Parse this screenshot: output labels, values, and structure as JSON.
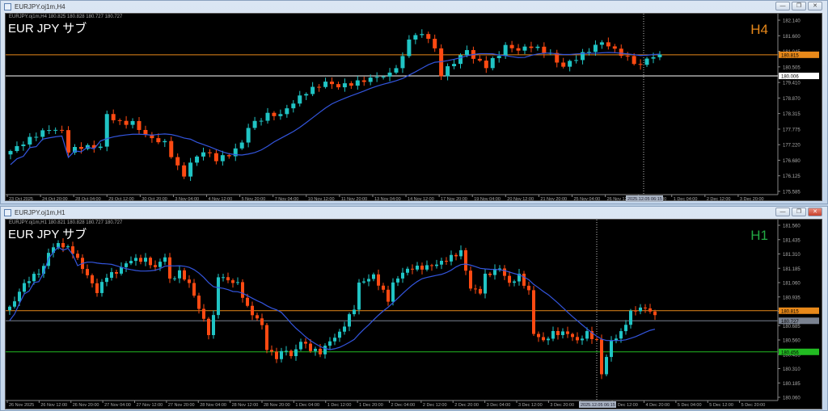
{
  "windows": [
    {
      "title": "EURJPY.oj1m,H4",
      "info": "EURJPY.oj1m,H4  180.825 180.828 180.727 180.727",
      "symbol_label": "EUR JPY  サブ",
      "timeframe": "H4",
      "timeframe_color": "#e8891a",
      "price_ticks": [
        "182.140",
        "181.600",
        "181.045",
        "180.505",
        "179.410",
        "178.870",
        "178.315",
        "177.775",
        "177.220",
        "176.680",
        "176.125",
        "175.585"
      ],
      "price_range": [
        175.585,
        182.14
      ],
      "level_lines": [
        {
          "price": 180.815,
          "label": "180.815",
          "color": "#e8891a"
        },
        {
          "price": 180.006,
          "label": "180.006",
          "color": "#ffffff"
        }
      ],
      "crosshair_time": "2025.12.05 06:15",
      "time_labels": [
        "23 Oct 2025",
        "24 Oct 20:00",
        "28 Oct 04:00",
        "29 Oct 12:00",
        "30 Oct 20:00",
        "3 Nov 04:00",
        "4 Nov 12:00",
        "5 Nov 20:00",
        "7 Nov 04:00",
        "10 Nov 12:00",
        "11 Nov 20:00",
        "13 Nov 04:00",
        "14 Nov 12:00",
        "17 Nov 20:00",
        "19 Nov 04:00",
        "20 Nov 12:00",
        "21 Nov 20:00",
        "25 Nov 04:00",
        "26 Nov 12:00",
        "27 Nov 20:00",
        "1 Dec 04:00",
        "2 Dec 12:00",
        "3 Dec 20:00"
      ],
      "candle_count": 102,
      "anchors": [
        [
          0,
          177.13
        ],
        [
          4,
          177.75
        ],
        [
          6,
          177.97
        ],
        [
          8,
          177.9
        ],
        [
          9,
          177.13
        ],
        [
          11,
          177.29
        ],
        [
          14,
          177.29
        ],
        [
          15,
          178.52
        ],
        [
          17,
          178.21
        ],
        [
          19,
          178.21
        ],
        [
          21,
          177.75
        ],
        [
          22,
          177.6
        ],
        [
          24,
          177.44
        ],
        [
          26,
          176.51
        ],
        [
          27,
          176.2
        ],
        [
          28,
          176.67
        ],
        [
          30,
          177.13
        ],
        [
          32,
          176.82
        ],
        [
          34,
          176.98
        ],
        [
          36,
          177.44
        ],
        [
          37,
          178.06
        ],
        [
          40,
          178.52
        ],
        [
          42,
          178.52
        ],
        [
          44,
          178.99
        ],
        [
          46,
          179.39
        ],
        [
          49,
          179.76
        ],
        [
          51,
          179.61
        ],
        [
          54,
          179.76
        ],
        [
          56,
          179.91
        ],
        [
          59,
          180.07
        ],
        [
          61,
          180.69
        ],
        [
          62,
          181.46
        ],
        [
          64,
          181.61
        ],
        [
          65,
          181.46
        ],
        [
          66,
          181.0
        ],
        [
          67,
          180.07
        ],
        [
          69,
          180.53
        ],
        [
          71,
          181.0
        ],
        [
          72,
          180.69
        ],
        [
          74,
          180.38
        ],
        [
          76,
          180.84
        ],
        [
          77,
          181.15
        ],
        [
          79,
          181.0
        ],
        [
          81,
          181.15
        ],
        [
          84,
          180.84
        ],
        [
          85,
          180.53
        ],
        [
          86,
          180.38
        ],
        [
          87,
          180.53
        ],
        [
          89,
          180.84
        ],
        [
          91,
          181.15
        ],
        [
          92,
          181.31
        ],
        [
          94,
          181.0
        ],
        [
          96,
          180.69
        ],
        [
          98,
          180.38
        ],
        [
          99,
          180.69
        ],
        [
          101,
          180.78
        ]
      ]
    },
    {
      "title": "EURJPY.oj1m,H1",
      "info": "EURJPY.oj1m,H1  180.821 180.828 180.727 180.727",
      "symbol_label": "EUR JPY  サブ",
      "timeframe": "H1",
      "timeframe_color": "#22aa44",
      "price_ticks": [
        "181.560",
        "181.435",
        "181.310",
        "181.185",
        "181.060",
        "180.935",
        "180.810",
        "180.685",
        "180.560",
        "180.435",
        "180.310",
        "180.185",
        "180.060"
      ],
      "price_range": [
        180.06,
        181.56
      ],
      "level_lines": [
        {
          "price": 180.815,
          "label": "180.815",
          "color": "#e8891a"
        },
        {
          "price": 180.727,
          "label": "180.727",
          "color": "#7a8290"
        },
        {
          "price": 180.456,
          "label": "180.456",
          "color": "#22bb22"
        }
      ],
      "crosshair_time": "2025.12.05 06:15",
      "time_labels": [
        "26 Nov 2025",
        "26 Nov 12:00",
        "26 Nov 20:00",
        "27 Nov 04:00",
        "27 Nov 12:00",
        "27 Nov 20:00",
        "28 Nov 04:00",
        "28 Nov 12:00",
        "28 Nov 20:00",
        "1 Dec 04:00",
        "1 Dec 12:00",
        "1 Dec 20:00",
        "2 Dec 04:00",
        "2 Dec 12:00",
        "2 Dec 20:00",
        "3 Dec 04:00",
        "3 Dec 12:00",
        "3 Dec 20:00",
        "4 Dec 04:00",
        "4 Dec 12:00",
        "4 Dec 20:00",
        "5 Dec 04:00",
        "5 Dec 12:00",
        "5 Dec 20:00"
      ],
      "candle_count": 134,
      "anchors": [
        [
          0,
          180.835
        ],
        [
          3,
          181.05
        ],
        [
          7,
          181.19
        ],
        [
          8,
          181.33
        ],
        [
          10,
          181.4
        ],
        [
          12,
          181.36
        ],
        [
          13,
          181.33
        ],
        [
          15,
          181.19
        ],
        [
          17,
          181.05
        ],
        [
          18,
          180.98
        ],
        [
          20,
          181.12
        ],
        [
          22,
          181.15
        ],
        [
          23,
          181.19
        ],
        [
          25,
          181.26
        ],
        [
          28,
          181.26
        ],
        [
          30,
          181.19
        ],
        [
          32,
          181.29
        ],
        [
          33,
          181.08
        ],
        [
          35,
          181.15
        ],
        [
          37,
          181.05
        ],
        [
          39,
          180.84
        ],
        [
          41,
          180.62
        ],
        [
          42,
          180.76
        ],
        [
          43,
          181.12
        ],
        [
          45,
          181.08
        ],
        [
          47,
          181.05
        ],
        [
          49,
          180.84
        ],
        [
          52,
          180.69
        ],
        [
          53,
          180.48
        ],
        [
          55,
          180.41
        ],
        [
          57,
          180.48
        ],
        [
          58,
          180.41
        ],
        [
          60,
          180.55
        ],
        [
          62,
          180.48
        ],
        [
          64,
          180.45
        ],
        [
          66,
          180.55
        ],
        [
          68,
          180.62
        ],
        [
          71,
          180.84
        ],
        [
          72,
          181.05
        ],
        [
          75,
          181.12
        ],
        [
          78,
          180.91
        ],
        [
          79,
          181.05
        ],
        [
          81,
          181.15
        ],
        [
          83,
          181.19
        ],
        [
          85,
          181.19
        ],
        [
          88,
          181.22
        ],
        [
          90,
          181.26
        ],
        [
          93,
          181.33
        ],
        [
          95,
          181.01
        ],
        [
          97,
          180.98
        ],
        [
          98,
          181.12
        ],
        [
          101,
          181.19
        ],
        [
          103,
          181.05
        ],
        [
          105,
          181.12
        ],
        [
          107,
          180.98
        ],
        [
          108,
          180.62
        ],
        [
          110,
          180.55
        ],
        [
          112,
          180.62
        ],
        [
          115,
          180.62
        ],
        [
          117,
          180.55
        ],
        [
          119,
          180.62
        ],
        [
          121,
          180.55
        ],
        [
          122,
          180.27
        ],
        [
          124,
          180.55
        ],
        [
          126,
          180.62
        ],
        [
          128,
          180.8
        ],
        [
          130,
          180.84
        ],
        [
          132,
          180.82
        ],
        [
          133,
          180.76
        ]
      ]
    }
  ],
  "colors": {
    "bull": "#20c4c4",
    "bear": "#ff4a12",
    "ma": "#3355dd"
  },
  "window_buttons": {
    "minimize": "—",
    "restore": "❐",
    "close": "✕"
  }
}
